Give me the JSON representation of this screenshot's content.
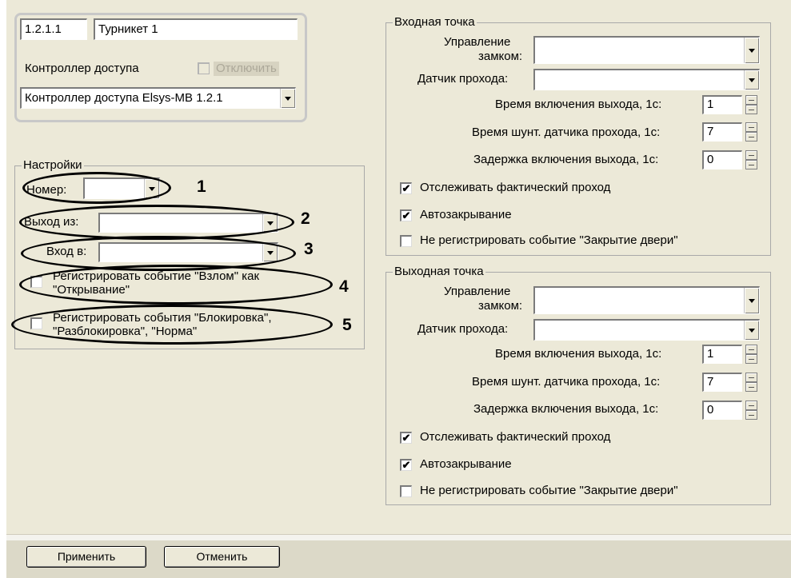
{
  "header": {
    "id_value": "1.2.1.1",
    "name_value": "Турникет 1",
    "controller_label": "Контроллер доступа",
    "disable_label": "Отключить",
    "controller_value": "Контроллер доступа Elsys-MB 1.2.1"
  },
  "settings": {
    "title": "Настройки",
    "number_label": "Номер:",
    "number_value": "",
    "exit_from_label": "Выход из:",
    "exit_from_value": "",
    "enter_to_label": "Вход в:",
    "enter_to_value": "",
    "reg_break_label_1": "Регистрировать событие \"Взлом\" как",
    "reg_break_label_2": "\"Открывание\"",
    "reg_block_label_1": "Регистрировать события \"Блокировка\",",
    "reg_block_label_2": "\"Разблокировка\", \"Норма\"",
    "reg_break_checked": false,
    "reg_block_checked": false
  },
  "annotations": [
    "1",
    "2",
    "3",
    "4",
    "5"
  ],
  "entry_point": {
    "title": "Входная точка",
    "lock_label_1": "Управление",
    "lock_label_2": "замком:",
    "lock_value": "",
    "sensor_label": "Датчик прохода:",
    "sensor_value": "",
    "output_time_label": "Время включения выхода, 1с:",
    "output_time_value": "1",
    "shunt_time_label": "Время шунт. датчика прохода, 1с:",
    "shunt_time_value": "7",
    "delay_label": "Задержка включения выхода, 1с:",
    "delay_value": "0",
    "track_label": "Отслеживать фактический проход",
    "track_checked": true,
    "autoclose_label": "Автозакрывание",
    "autoclose_checked": true,
    "no_reg_label": "Не регистрировать событие \"Закрытие двери\"",
    "no_reg_checked": false
  },
  "exit_point": {
    "title": "Выходная точка",
    "lock_label_1": "Управление",
    "lock_label_2": "замком:",
    "lock_value": "",
    "sensor_label": "Датчик прохода:",
    "sensor_value": "",
    "output_time_label": "Время включения выхода, 1с:",
    "output_time_value": "1",
    "shunt_time_label": "Время шунт. датчика прохода, 1с:",
    "shunt_time_value": "7",
    "delay_label": "Задержка включения выхода, 1с:",
    "delay_value": "0",
    "track_label": "Отслеживать фактический проход",
    "track_checked": true,
    "autoclose_label": "Автозакрывание",
    "autoclose_checked": true,
    "no_reg_label": "Не регистрировать событие \"Закрытие двери\"",
    "no_reg_checked": false
  },
  "buttons": {
    "apply": "Применить",
    "cancel": "Отменить"
  },
  "check_mark": "✔"
}
